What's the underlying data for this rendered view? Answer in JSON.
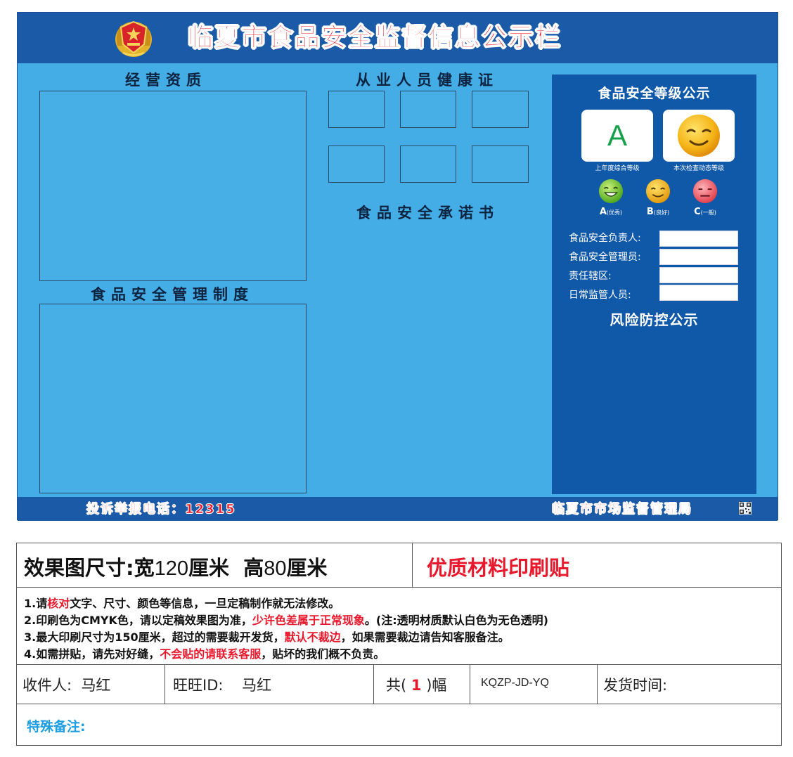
{
  "board": {
    "title": "临夏市食品安全监督信息公示栏",
    "sections": {
      "business_qualification": "经营资质",
      "health_certificate": "从业人员健康证",
      "safety_commitment": "食品安全承诺书",
      "management_system": "食品安全管理制度"
    },
    "panel": {
      "title": "食品安全等级公示",
      "grade_letter": "A",
      "caption_left": "上年度综合等级",
      "caption_right": "本次检查动态等级",
      "levels": [
        {
          "letter": "A",
          "note": "(优秀)"
        },
        {
          "letter": "B",
          "note": "(良好)"
        },
        {
          "letter": "C",
          "note": "(一般)"
        }
      ],
      "fields": [
        "食品安全负责人:",
        "食品安全管理员:",
        "责任辖区:",
        "日常监管人员:"
      ],
      "risk_title": "风险防控公示"
    },
    "footer": {
      "hotline": "投诉举报电话：12315",
      "bureau": "临夏市市场监督管理局"
    },
    "colors": {
      "board_bg": "#44ade6",
      "header_bg": "#1b5aa6",
      "panel_bg": "#1058a8",
      "title_red": "#e8192c"
    }
  },
  "order": {
    "size_label": "效果图尺寸:",
    "width_label": "宽",
    "width_value": "120",
    "height_label": "高",
    "height_value": "80",
    "unit": "厘米",
    "material": "优质材料印刷贴",
    "notes": [
      {
        "parts": [
          "1.请",
          "核对",
          "文字、尺寸、颜色等信息，一旦定稿制作就无法修改。"
        ]
      },
      {
        "parts": [
          "2.印刷色为CMYK色，请以定稿效果图为准，",
          "少许色差属于正常现象",
          "。(注:透明材质默认白色为无色透明)"
        ]
      },
      {
        "parts": [
          "3.最大印刷尺寸为150厘米，超过的需要裁开发货，",
          "默认不裁边",
          "，如果需要裁边请告知客服备注。"
        ]
      },
      {
        "parts": [
          "4.如需拼贴，请先对好缝，",
          "不会贴的请联系客服",
          "，贴坏的我们概不负责。"
        ]
      }
    ],
    "recipient_label": "收件人:",
    "recipient": "马红",
    "wangwang_label": "旺旺ID:",
    "wangwang": "马红",
    "count_prefix": "共(",
    "count": "1",
    "count_suffix": ")幅",
    "code": "KQZP-JD-YQ",
    "ship_time_label": "发货时间:",
    "remark_label": "特殊备注:"
  }
}
